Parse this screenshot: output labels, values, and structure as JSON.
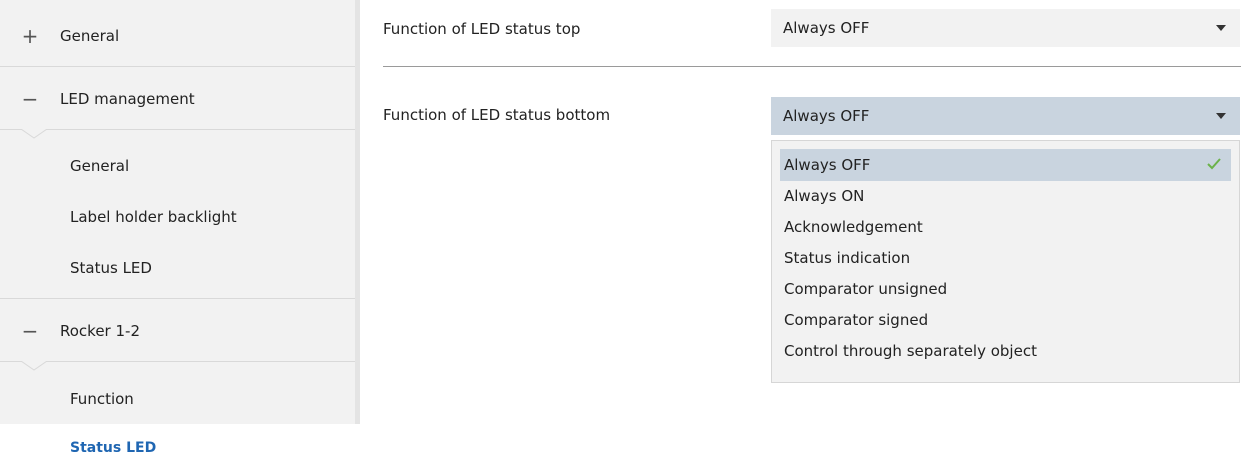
{
  "sidebar": {
    "sections": [
      {
        "sign": "+",
        "label": "General"
      },
      {
        "sign": "−",
        "label": "LED management"
      },
      {
        "sign": "−",
        "label": "Rocker 1-2"
      }
    ],
    "led_items": [
      "General",
      "Label holder backlight",
      "Status LED"
    ],
    "rocker_items": [
      "Function",
      "Status LED"
    ]
  },
  "main": {
    "top": {
      "label": "Function of LED status top",
      "value": "Always OFF"
    },
    "bottom": {
      "label": "Function of LED status bottom",
      "value": "Always OFF"
    },
    "options": [
      "Always OFF",
      "Always ON",
      "Acknowledgement",
      "Status indication",
      "Comparator unsigned",
      "Comparator signed",
      "Control through separately object"
    ],
    "selected_option": "Always OFF"
  },
  "colors": {
    "active_item": "#1f66b2",
    "selection": "#c9d4df",
    "check": "#6bb24a"
  }
}
